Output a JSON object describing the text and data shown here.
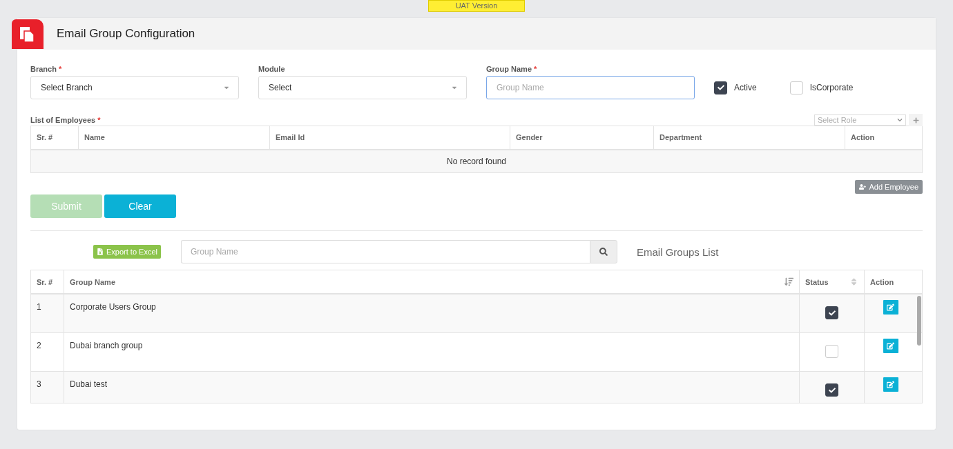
{
  "badge": "UAT Version",
  "page": {
    "title": "Email Group Configuration"
  },
  "required_mark": "*",
  "form": {
    "fields": [
      {
        "label": "Branch",
        "required": true,
        "kind": "select",
        "value": "Select Branch"
      },
      {
        "label": "Module",
        "required": false,
        "kind": "select",
        "value": "Select"
      },
      {
        "label": "Group Name",
        "required": true,
        "kind": "input",
        "placeholder": "Group Name"
      }
    ],
    "checkboxes": [
      {
        "label": "Active",
        "checked": true
      },
      {
        "label": "IsCorporate",
        "checked": false
      }
    ]
  },
  "employees": {
    "label": "List of Employees",
    "required": true,
    "role_select": "Select Role",
    "columns": [
      "Sr. #",
      "Name",
      "Email Id",
      "Gender",
      "Department",
      "Action"
    ],
    "empty_text": "No record found",
    "add_button": "Add Employee"
  },
  "buttons": [
    {
      "label": "Submit",
      "kind": "submit",
      "disabled": true
    },
    {
      "label": "Clear",
      "kind": "clear",
      "disabled": false
    }
  ],
  "list": {
    "export_button": "Export to Excel",
    "search_placeholder": "Group Name",
    "title": "Email Groups List",
    "columns": [
      "Sr. #",
      "Group Name",
      "Status",
      "Action"
    ],
    "rows": [
      {
        "sr": "1",
        "name": "Corporate Users Group",
        "checked": true
      },
      {
        "sr": "2",
        "name": "Dubai branch group",
        "checked": false
      },
      {
        "sr": "3",
        "name": "Dubai test",
        "checked": true
      }
    ]
  }
}
